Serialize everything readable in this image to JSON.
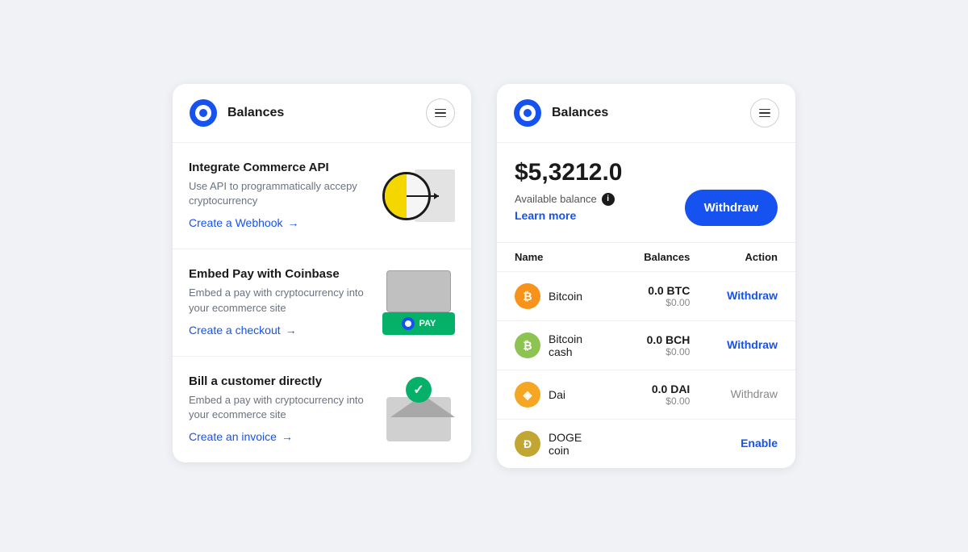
{
  "leftCard": {
    "header": {
      "title": "Balances",
      "logoAlt": "Coinbase logo",
      "menuLabel": "Menu"
    },
    "sections": [
      {
        "id": "api",
        "title": "Integrate Commerce API",
        "description": "Use API to programmatically accepy cryptocurrency",
        "linkText": "Create a Webhook",
        "linkArrow": "→"
      },
      {
        "id": "pay",
        "title": "Embed Pay with Coinbase",
        "description": "Embed a pay with cryptocurrency into your ecommerce site",
        "linkText": "Create a checkout",
        "linkArrow": "→"
      },
      {
        "id": "invoice",
        "title": "Bill a customer directly",
        "description": "Embed a pay with cryptocurrency into your ecommerce site",
        "linkText": "Create an invoice",
        "linkArrow": "→"
      }
    ]
  },
  "rightCard": {
    "header": {
      "title": "Balances",
      "logoAlt": "Coinbase logo",
      "menuLabel": "Menu"
    },
    "balance": {
      "amount": "$5,3212.0",
      "label": "Available balance",
      "learnMore": "Learn more",
      "withdrawButton": "Withdraw"
    },
    "table": {
      "headers": [
        "Name",
        "Balances",
        "Action"
      ],
      "rows": [
        {
          "coin": "Bitcoin",
          "symbol": "BTC",
          "iconLetter": "₿",
          "iconClass": "coin-btc",
          "balanceCrypto": "0.0 BTC",
          "balanceUsd": "$0.00",
          "action": "Withdraw",
          "actionActive": true
        },
        {
          "coin": "Bitcoin cash",
          "symbol": "BCH",
          "iconLetter": "₿",
          "iconClass": "coin-bch",
          "balanceCrypto": "0.0 BCH",
          "balanceUsd": "$0.00",
          "action": "Withdraw",
          "actionActive": true
        },
        {
          "coin": "Dai",
          "symbol": "DAI",
          "iconLetter": "◈",
          "iconClass": "coin-dai",
          "balanceCrypto": "0.0 DAI",
          "balanceUsd": "$0.00",
          "action": "Withdraw",
          "actionActive": false
        },
        {
          "coin": "DOGE coin",
          "symbol": "DOGE",
          "iconLetter": "Ð",
          "iconClass": "coin-doge",
          "balanceCrypto": "",
          "balanceUsd": "",
          "action": "Enable",
          "actionActive": true
        }
      ]
    }
  }
}
